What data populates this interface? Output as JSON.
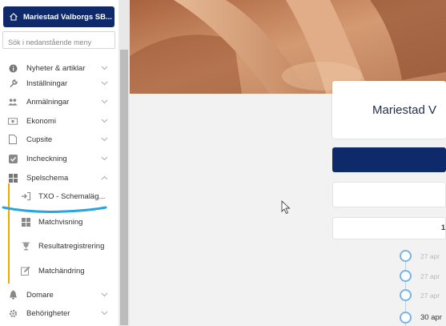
{
  "sidebar": {
    "site_name": "Mariestad Valborgs SB...",
    "search_placeholder": "Sök i nedanstående meny",
    "items": [
      {
        "label": "Nyheter & artiklar",
        "icon": "info-icon"
      },
      {
        "label": "Inställningar",
        "icon": "wrench-icon"
      },
      {
        "label": "Anmälningar",
        "icon": "users-icon"
      },
      {
        "label": "Ekonomi",
        "icon": "money-icon"
      },
      {
        "label": "Cupsite",
        "icon": "document-icon"
      },
      {
        "label": "Incheckning",
        "icon": "checkbox-icon"
      },
      {
        "label": "Spelschema",
        "icon": "grid-icon"
      }
    ],
    "sub_items": [
      {
        "label": "TXO - Schemaläg...",
        "icon": "sign-in-icon"
      },
      {
        "label": "Matchvisning",
        "icon": "grid-icon"
      },
      {
        "label": "Resultatregistrering",
        "icon": "trophy-icon"
      },
      {
        "label": "Matchändring",
        "icon": "edit-icon"
      }
    ],
    "items_after": [
      {
        "label": "Domare",
        "icon": "referee-icon"
      },
      {
        "label": "Behörigheter",
        "icon": "gear-icon"
      }
    ]
  },
  "main": {
    "club_title": "Mariestad V",
    "box2_text": "1",
    "timeline": [
      {
        "text": "27 apr"
      },
      {
        "text": "27 apr"
      },
      {
        "text": "27 apr"
      },
      {
        "text": "30 apr"
      }
    ]
  },
  "colors": {
    "brand_navy": "#0f2a6b",
    "accent_yellow": "#f0a800",
    "timeline_blue": "#7ab4e6",
    "annotation_blue": "#2aa4de"
  }
}
